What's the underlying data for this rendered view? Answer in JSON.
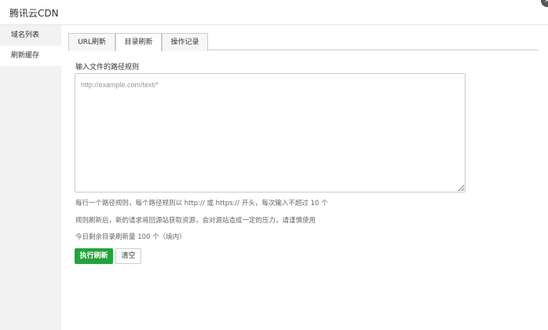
{
  "window": {
    "title": "腾讯云CDN",
    "close_glyph": "×"
  },
  "sidebar": {
    "items": [
      {
        "label": "域名列表"
      },
      {
        "label": "刷新缓存"
      }
    ]
  },
  "tabs": [
    {
      "label": "URL刷新"
    },
    {
      "label": "目录刷新"
    },
    {
      "label": "操作记录"
    }
  ],
  "form": {
    "label": "输入文件的路径规则",
    "placeholder": "http://example.com/text/*",
    "notes": [
      "每行一个路径规则，每个路径规则以 http:// 或 https:// 开头，每次输入不超过 10 个",
      "规则刷新后，新的请求将回源站获取资源，会对源站造成一定的压力，请谨慎使用",
      "今日剩余目录刷新量 100 个（境内）"
    ],
    "submit_label": "执行刷新",
    "clear_label": "清空"
  },
  "colors": {
    "accent": "#20a53a",
    "sidebar_bg": "#f2f2f2"
  }
}
